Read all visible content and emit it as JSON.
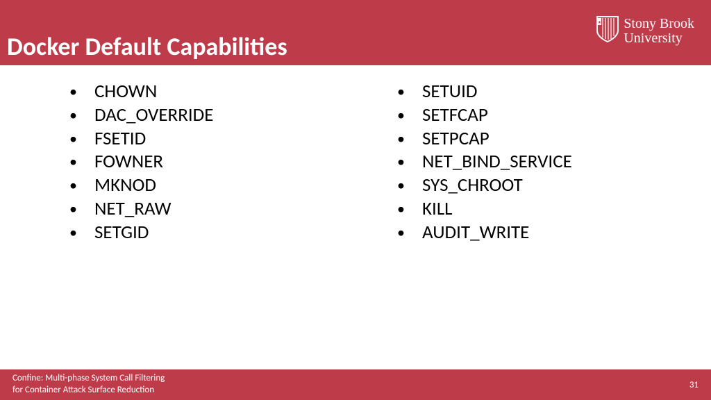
{
  "header": {
    "title": "Docker Default Capabilities",
    "logo": {
      "line1": "Stony Brook",
      "line2": "University"
    }
  },
  "content": {
    "left_items": [
      "CHOWN",
      "DAC_OVERRIDE",
      "FSETID",
      "FOWNER",
      "MKNOD",
      "NET_RAW",
      "SETGID"
    ],
    "right_items": [
      "SETUID",
      "SETFCAP",
      "SETPCAP",
      "NET_BIND_SERVICE",
      "SYS_CHROOT",
      "KILL",
      "AUDIT_WRITE"
    ]
  },
  "footer": {
    "line1": "Confine: Multi-phase System Call Filtering",
    "line2": "for Container Attack Surface Reduction",
    "page": "31"
  },
  "colors": {
    "brand": "#be3b4a"
  }
}
